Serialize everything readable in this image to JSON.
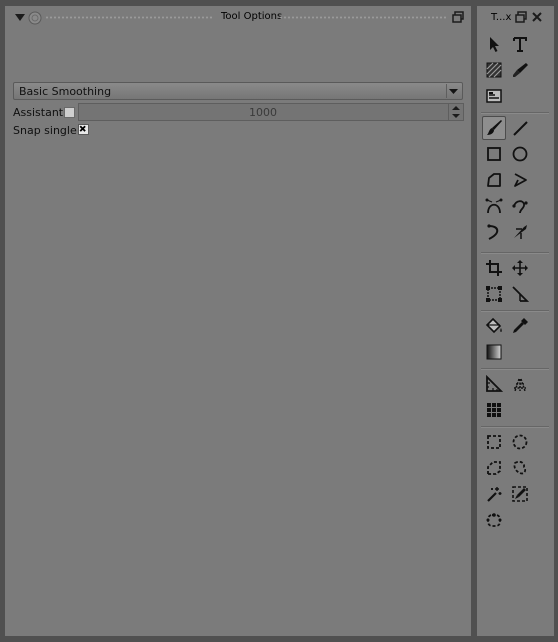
{
  "tool_options": {
    "title": "Tool Options",
    "smoothing_select": {
      "value": "Basic Smoothing"
    },
    "assistant": {
      "label": "Assistant:",
      "checked": false,
      "value": "1000"
    },
    "snap_single": {
      "label": "Snap single:",
      "checked": true
    }
  },
  "toolbox": {
    "title": "T...x",
    "tools": [
      {
        "id": "select-shapes",
        "icon": "arrow-pointer-icon"
      },
      {
        "id": "text",
        "icon": "text-icon"
      },
      {
        "id": "edit-shapes",
        "icon": "hatched-square-icon"
      },
      {
        "id": "calligraphy",
        "icon": "calligraphy-pen-icon"
      },
      {
        "id": "reference-images",
        "icon": "reference-image-icon"
      },
      {
        "id": "freehand-brush",
        "icon": "brush-icon",
        "active": true
      },
      {
        "id": "line",
        "icon": "line-icon"
      },
      {
        "id": "rectangle",
        "icon": "rectangle-icon"
      },
      {
        "id": "ellipse",
        "icon": "ellipse-icon"
      },
      {
        "id": "polygon",
        "icon": "polygon-icon"
      },
      {
        "id": "polyline",
        "icon": "polyline-icon"
      },
      {
        "id": "bezier-curve",
        "icon": "bezier-curve-icon"
      },
      {
        "id": "freehand-path",
        "icon": "freehand-path-icon"
      },
      {
        "id": "dynamic-brush",
        "icon": "dynamic-brush-icon"
      },
      {
        "id": "multibrush",
        "icon": "multibrush-icon"
      },
      {
        "id": "crop",
        "icon": "crop-icon"
      },
      {
        "id": "move",
        "icon": "move-icon"
      },
      {
        "id": "transform",
        "icon": "transform-icon"
      },
      {
        "id": "measure",
        "icon": "measure-icon"
      },
      {
        "id": "fill",
        "icon": "paint-bucket-icon"
      },
      {
        "id": "color-picker",
        "icon": "eyedropper-icon"
      },
      {
        "id": "gradient",
        "icon": "gradient-icon"
      },
      {
        "id": "assistant",
        "icon": "assistant-ruler-icon"
      },
      {
        "id": "perspective-grid",
        "icon": "perspective-grid-icon"
      },
      {
        "id": "grid",
        "icon": "grid-icon"
      },
      {
        "id": "rect-select",
        "icon": "rect-select-icon"
      },
      {
        "id": "ellipse-select",
        "icon": "ellipse-select-icon"
      },
      {
        "id": "polygon-select",
        "icon": "polygon-select-icon"
      },
      {
        "id": "freehand-select",
        "icon": "freehand-select-icon"
      },
      {
        "id": "magic-wand",
        "icon": "magic-wand-icon"
      },
      {
        "id": "similar-select",
        "icon": "similar-select-icon"
      },
      {
        "id": "path-select",
        "icon": "path-select-icon"
      }
    ]
  }
}
